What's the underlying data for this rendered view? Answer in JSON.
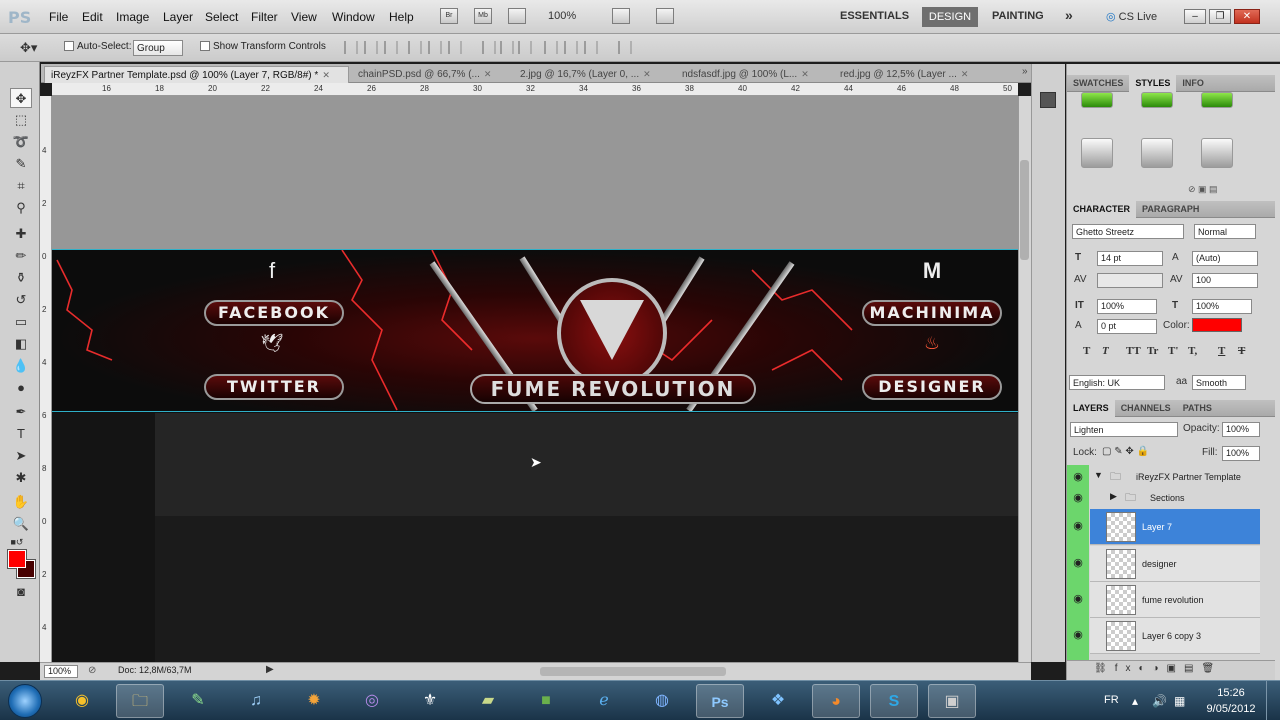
{
  "app": {
    "logo": "PS"
  },
  "menu": [
    "File",
    "Edit",
    "Image",
    "Layer",
    "Select",
    "Filter",
    "View",
    "Window",
    "Help"
  ],
  "appbar": {
    "bridge": "Br",
    "minibridge": "Mb",
    "zoom": "100%",
    "workspaces": [
      "ESSENTIALS",
      "DESIGN",
      "PAINTING"
    ],
    "more": "»",
    "cslive": "CS Live"
  },
  "options": {
    "auto_select": "Auto-Select:",
    "group_value": "Group",
    "transform_controls": "Show Transform Controls"
  },
  "doc_tabs": [
    {
      "label": "iReyzFX Partner Template.psd @ 100% (Layer 7, RGB/8#) *"
    },
    {
      "label": "chainPSD.psd @ 66,7% (..."
    },
    {
      "label": "2.jpg @ 16,7% (Layer 0, ..."
    },
    {
      "label": "ndsfasdf.jpg @ 100% (L..."
    },
    {
      "label": "red.jpg @ 12,5% (Layer ..."
    }
  ],
  "ruler_h": [
    "16",
    "18",
    "20",
    "22",
    "24",
    "26",
    "28",
    "30",
    "32",
    "34",
    "36",
    "38",
    "40",
    "42",
    "44",
    "46",
    "48",
    "50"
  ],
  "ruler_v": [
    "4",
    "2",
    "0",
    "2",
    "4",
    "6",
    "8",
    "0",
    "2",
    "4"
  ],
  "banner": {
    "left_buttons": [
      "FACEBOOK",
      "TWITTER"
    ],
    "right_buttons": [
      "MACHINIMA",
      "DESIGNER"
    ],
    "center_title": "FUME REVOLUTION",
    "icons": {
      "facebook": "f",
      "twitter": "bird",
      "machinima": "M",
      "designer": "flame"
    }
  },
  "status": {
    "zoom": "100%",
    "doc": "Doc: 12,8M/63,7M"
  },
  "panels": {
    "swatch_tabs": [
      "SWATCHES",
      "STYLES",
      "INFO"
    ],
    "char_tabs": [
      "CHARACTER",
      "PARAGRAPH"
    ],
    "character": {
      "font": "Ghetto Streetz",
      "style": "Normal",
      "size": "14 pt",
      "leading": "(Auto)",
      "kerning": "",
      "tracking": "100",
      "vscale": "100%",
      "hscale": "100%",
      "baseline": "0 pt",
      "color_label": "Color:",
      "language": "English: UK",
      "antialias_icon": "aa",
      "antialias": "Smooth",
      "color": "#ff0000"
    },
    "glyph_buttons": [
      "T",
      "T",
      "TT",
      "Tr",
      "T'",
      "T,",
      "T",
      "T"
    ],
    "layer_tabs": [
      "LAYERS",
      "CHANNELS",
      "PATHS"
    ],
    "layers": {
      "blend": "Lighten",
      "opacity_label": "Opacity:",
      "opacity": "100%",
      "lock_label": "Lock:",
      "fill_label": "Fill:",
      "fill": "100%",
      "group": "iReyzFX Partner Template",
      "subgroup": "Sections",
      "items": [
        "Layer 7",
        "designer",
        "fume revolution",
        "Layer 6 copy 3"
      ]
    }
  },
  "taskbar": {
    "lang": "FR",
    "time": "15:26",
    "date": "9/05/2012"
  }
}
